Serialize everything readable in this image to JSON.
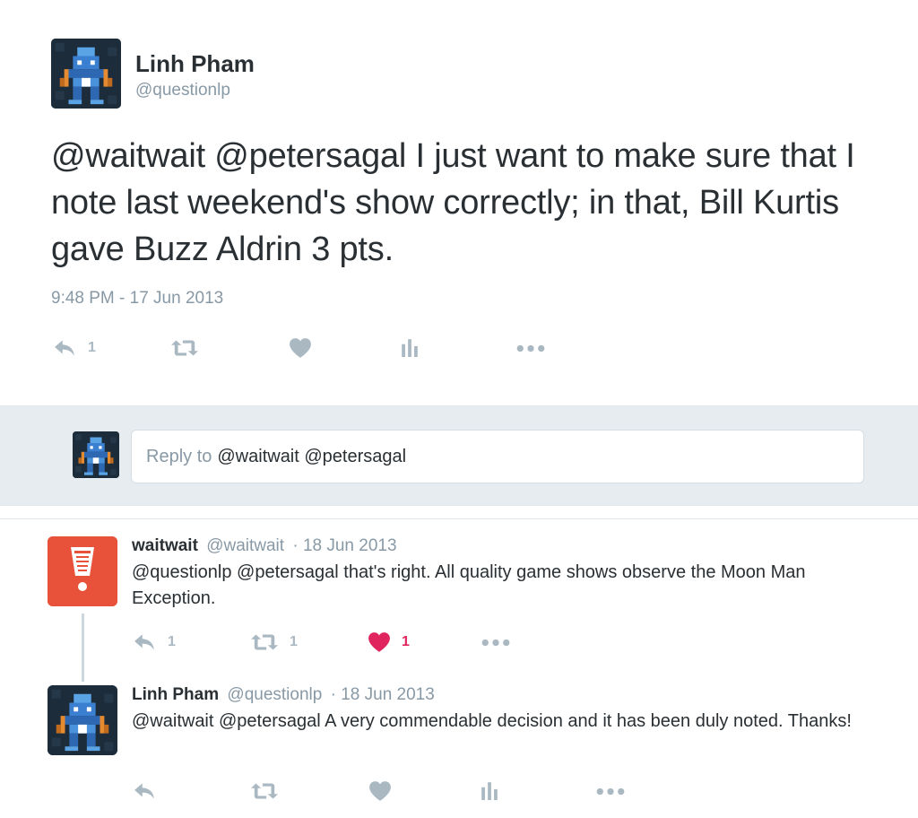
{
  "main_tweet": {
    "name": "Linh Pham",
    "handle": "@questionlp",
    "text": "@waitwait @petersagal I just want to make sure that I note last weekend's show correctly; in that, Bill Kurtis gave Buzz Aldrin 3 pts.",
    "timestamp": "9:48 PM - 17 Jun 2013",
    "actions": {
      "reply_count": "1",
      "retweet_count": "",
      "like_count": ""
    }
  },
  "reply_box": {
    "placeholder": "Reply to",
    "mentions": "@waitwait @petersagal"
  },
  "replies": [
    {
      "name": "waitwait",
      "handle": "@waitwait",
      "date": "· 18 Jun 2013",
      "text": "@questionlp @petersagal that's right. All quality game shows observe the Moon Man Exception.",
      "reply_count": "1",
      "retweet_count": "1",
      "like_count": "1",
      "liked": true
    },
    {
      "name": "Linh Pham",
      "handle": "@questionlp",
      "date": "· 18 Jun 2013",
      "text": "@waitwait @petersagal A very commendable decision and it has been duly noted. Thanks!",
      "reply_count": "",
      "retweet_count": "",
      "like_count": "",
      "liked": false
    }
  ],
  "colors": {
    "text": "#292f33",
    "muted": "#8899a6",
    "icon": "#aab8c2",
    "like_active": "#e0245e",
    "reply_bar_bg": "#e6ecf0",
    "waitwait_brand": "#e8523a"
  }
}
